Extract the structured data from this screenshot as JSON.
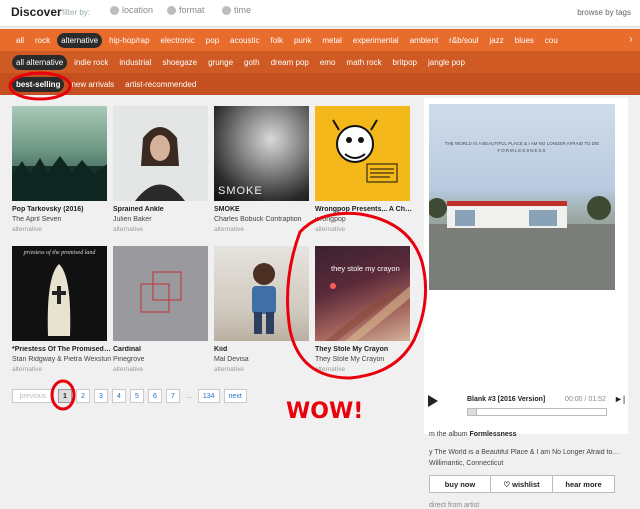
{
  "header": {
    "title": "Discover",
    "filter_label": "filter by:",
    "filters": [
      "location",
      "format",
      "time"
    ],
    "browse": "browse by tags"
  },
  "genres": [
    "all",
    "rock",
    "alternative",
    "hip-hop/rap",
    "electronic",
    "pop",
    "acoustic",
    "folk",
    "punk",
    "metal",
    "experimental",
    "ambient",
    "r&b/soul",
    "jazz",
    "blues",
    "cou"
  ],
  "subgenres": [
    "all alternative",
    "indie rock",
    "industrial",
    "shoegaze",
    "grunge",
    "goth",
    "dream pop",
    "emo",
    "math rock",
    "britpop",
    "jangle pop"
  ],
  "sorts": [
    "best-selling",
    "new arrivals",
    "artist-recommended"
  ],
  "albums": [
    {
      "title": "Pop Tarkovsky (2016)",
      "artist": "The April Seven",
      "genre": "alternative"
    },
    {
      "title": "Sprained Ankle",
      "artist": "Julien Baker",
      "genre": "alternative"
    },
    {
      "title": "SMOKE",
      "artist": "Charles Bobuck Contraption",
      "genre": "alternative",
      "cover_text": "SMOKE"
    },
    {
      "title": "Wrongpop Presents... A Ch…",
      "artist": "wrongpop",
      "genre": "alternative"
    },
    {
      "title": "*Priestess Of The Promised…",
      "artist": "Stan Ridgway & Pietra Wexstun",
      "genre": "alternative",
      "cover_text": "priestess of the promised land"
    },
    {
      "title": "Cardinal",
      "artist": "Pinegrove",
      "genre": "alternative"
    },
    {
      "title": "Kiid",
      "artist": "Mal Devisa",
      "genre": "alternative"
    },
    {
      "title": "They Stole My Crayon",
      "artist": "They Stole My Crayon",
      "genre": "alternative",
      "cover_text": "they stole my crayon"
    }
  ],
  "pager": {
    "prev": "previous",
    "pages": [
      "1",
      "2",
      "3",
      "4",
      "5",
      "6",
      "7"
    ],
    "ellipsis": "...",
    "last": "134",
    "next": "next"
  },
  "player": {
    "cover_text": "THE WORLD IS A BEAUTIFUL PLACE & I AM NO LONGER AFRAID TO DIE",
    "cover_sub": "FORMLESSNESS",
    "track": "Blank #3 [2016 Version]",
    "time": "00:00 / 01:52",
    "from_prefix": "m the album",
    "album": "Formlessness",
    "byline": "y The World is a Beautiful Place & I am No Longer Afraid to…",
    "location": "Willimantic, Connecticut",
    "buttons": [
      "buy now",
      "wishlist",
      "hear more"
    ],
    "direct": "direct from artist",
    "progress": 0
  },
  "annotation_text": "WOW!",
  "colors": {
    "accent": "#e86c2c",
    "annotation": "#e8000d"
  }
}
